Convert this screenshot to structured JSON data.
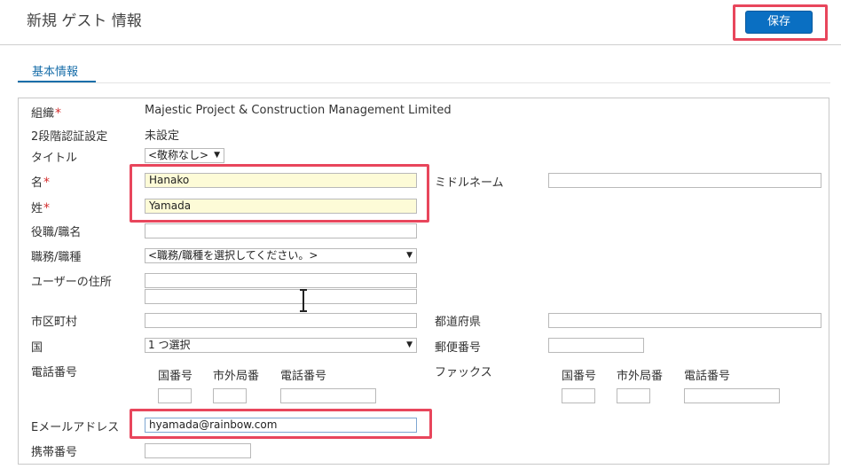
{
  "header": {
    "title": "新規 ゲスト 情報",
    "save_label": "保存"
  },
  "tabs": [
    {
      "label": "基本情報",
      "active": true
    }
  ],
  "form": {
    "organization": {
      "label": "組織",
      "value": "Majestic Project & Construction Management Limited"
    },
    "two_factor": {
      "label": "2段階認証設定",
      "value": "未設定"
    },
    "salutation": {
      "label": "タイトル",
      "value": "<敬称なし>"
    },
    "first_name": {
      "label": "名",
      "value": "Hanako"
    },
    "middle_name": {
      "label": "ミドルネーム",
      "value": ""
    },
    "last_name": {
      "label": "姓",
      "value": "Yamada"
    },
    "job_title": {
      "label": "役職/職名",
      "value": ""
    },
    "job_role": {
      "label": "職務/職種",
      "value": "<職務/職種を選択してください。>"
    },
    "address": {
      "label": "ユーザーの住所",
      "line1": "",
      "line2": ""
    },
    "city": {
      "label": "市区町村",
      "value": ""
    },
    "state": {
      "label": "都道府県",
      "value": ""
    },
    "country": {
      "label": "国",
      "value": "1 つ選択"
    },
    "postal": {
      "label": "郵便番号",
      "value": ""
    },
    "phone": {
      "label": "電話番号",
      "country_code_label": "国番号",
      "area_code_label": "市外局番",
      "number_label": "電話番号"
    },
    "fax": {
      "label": "ファックス",
      "country_code_label": "国番号",
      "area_code_label": "市外局番",
      "number_label": "電話番号"
    },
    "email": {
      "label": "Eメールアドレス",
      "value": "hyamada@rainbow.com"
    },
    "mobile": {
      "label": "携帯番号",
      "value": ""
    },
    "required_mark": "*"
  },
  "colors": {
    "accent": "#0a6fc2",
    "highlight": "#e8465c",
    "required": "#d42d2d",
    "required_fill": "#fdfbd7"
  }
}
